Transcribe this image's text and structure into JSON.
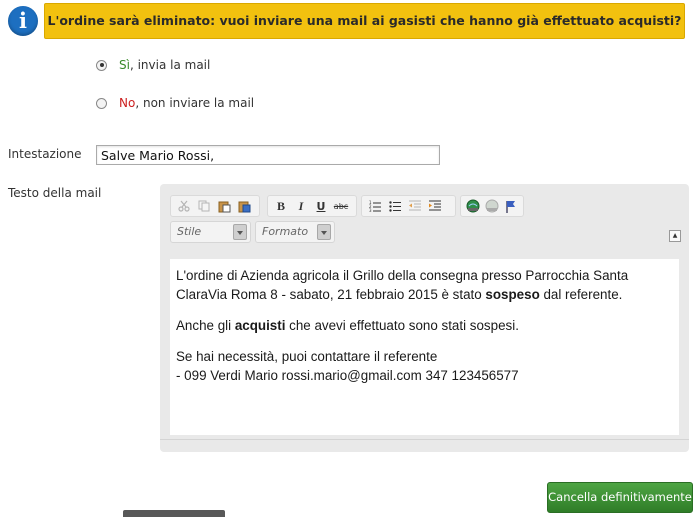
{
  "banner": {
    "icon": "info-icon",
    "icon_glyph": "i",
    "message": "L'ordine sarà eliminato: vuoi inviare una mail ai gasisti che hanno già effettuato acquisti?"
  },
  "options": {
    "send": {
      "label_em": "Sì",
      "label_rest": ", invia la mail",
      "checked": true
    },
    "nosend": {
      "label_em": "No",
      "label_rest": ", non inviare la mail",
      "checked": false
    }
  },
  "form": {
    "heading_label": "Intestazione",
    "heading_value": "Salve Mario Rossi,",
    "body_label": "Testo della mail"
  },
  "editor": {
    "toolbar": {
      "bold": "B",
      "italic": "I",
      "underline": "U",
      "strike": "abc",
      "style_placeholder": "Stile",
      "format_placeholder": "Formato",
      "collapse": "▲"
    },
    "content": {
      "line1_pre": "L'ordine di Azienda agricola il Grillo della consegna presso Parrocchia Santa ClaraVia Roma 8 - sabato, 21 febbraio 2015 è stato ",
      "line1_bold": "sospeso",
      "line1_post": " dal referente.",
      "line2_pre": "Anche gli ",
      "line2_bold": "acquisti",
      "line2_post": " che avevi effettuato sono stati sospesi.",
      "line3": "Se hai necessità, puoi contattare il referente",
      "line4": "- 099 Verdi Mario rossi.mario@gmail.com 347 123456577"
    }
  },
  "actions": {
    "delete_label": "Cancella definitivamente"
  },
  "colors": {
    "banner_bg": "#f2c10f",
    "button_green": "#3d8f35",
    "yes_color": "#3a8a2a",
    "no_color": "#cc2020"
  }
}
